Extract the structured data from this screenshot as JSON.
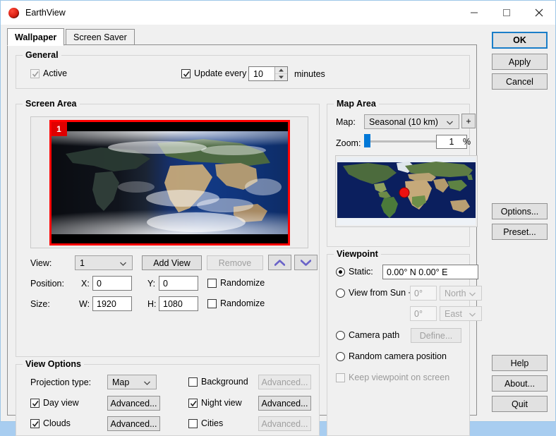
{
  "window": {
    "title": "EarthView",
    "icon": "globe-icon",
    "controls": {
      "minimize": "minimize-icon",
      "maximize": "maximize-icon",
      "close": "close-icon"
    }
  },
  "tabs": [
    {
      "label": "Wallpaper",
      "active": true
    },
    {
      "label": "Screen Saver",
      "active": false
    }
  ],
  "general": {
    "legend": "General",
    "active": {
      "label": "Active",
      "checked": true
    },
    "update_every": {
      "label": "Update every",
      "checked": true,
      "value": "10",
      "unit": "minutes"
    }
  },
  "screen_area": {
    "legend": "Screen Area",
    "badge": "1",
    "view": {
      "label": "View:",
      "value": "1"
    },
    "add_view": "Add View",
    "remove": "Remove",
    "move_up": "chevron-up-icon",
    "move_down": "chevron-down-icon",
    "position": {
      "label": "Position:",
      "x_label": "X:",
      "x": "0",
      "y_label": "Y:",
      "y": "0",
      "randomize": "Randomize",
      "randomize_checked": false
    },
    "size": {
      "label": "Size:",
      "w_label": "W:",
      "w": "1920",
      "h_label": "H:",
      "h": "1080",
      "randomize": "Randomize",
      "randomize_checked": false
    }
  },
  "view_options": {
    "legend": "View Options",
    "projection": {
      "label": "Projection type:",
      "value": "Map"
    },
    "day_view": {
      "label": "Day view",
      "checked": true,
      "button": "Advanced...",
      "enabled": true
    },
    "clouds": {
      "label": "Clouds",
      "checked": true,
      "button": "Advanced...",
      "enabled": true
    },
    "background": {
      "label": "Background",
      "checked": false,
      "button": "Advanced...",
      "enabled": false
    },
    "night_view": {
      "label": "Night view",
      "checked": true,
      "button": "Advanced...",
      "enabled": true
    },
    "cities": {
      "label": "Cities",
      "checked": false,
      "button": "Advanced...",
      "enabled": false
    }
  },
  "map_area": {
    "legend": "Map Area",
    "map": {
      "label": "Map:",
      "value": "Seasonal (10 km)",
      "add": "+"
    },
    "zoom": {
      "label": "Zoom:",
      "value": "1",
      "unit": "%",
      "percent": 1
    },
    "marker": {
      "x_pct": 48.5,
      "y_pct": 52
    }
  },
  "viewpoint": {
    "legend": "Viewpoint",
    "static": {
      "label": "Static:",
      "selected": true,
      "value": "0.00° N   0.00° E"
    },
    "view_from_sun": {
      "label": "View from Sun +",
      "selected": false,
      "angle1": "0°",
      "dir1": "North",
      "angle2": "0°",
      "dir2": "East"
    },
    "camera_path": {
      "label": "Camera path",
      "selected": false,
      "button": "Define..."
    },
    "random_camera": {
      "label": "Random camera position",
      "selected": false
    },
    "keep_on_screen": {
      "label": "Keep viewpoint on screen",
      "checked": false,
      "enabled": false
    }
  },
  "side_buttons": {
    "ok": "OK",
    "apply": "Apply",
    "cancel": "Cancel",
    "options": "Options...",
    "preset": "Preset...",
    "help": "Help",
    "about": "About...",
    "quit": "Quit"
  },
  "colors": {
    "accent": "#0078d7",
    "default_button_border": "#1a7ec8",
    "marker_red": "#ee1111",
    "badge_red": "#e00000",
    "chevron_purple": "#6a63c8",
    "window_border": "#9ec7e8"
  }
}
